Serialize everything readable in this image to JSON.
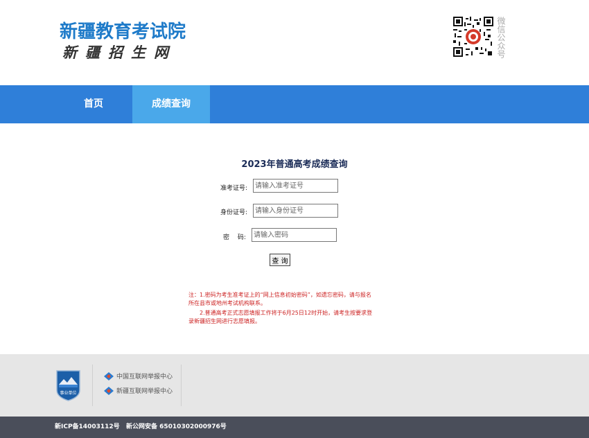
{
  "header": {
    "logo_main": "新疆教育考试院",
    "logo_sub": "新疆招生网",
    "qr_caption": "微信公众号"
  },
  "nav": {
    "items": [
      {
        "label": "首页"
      },
      {
        "label": "成绩查询"
      }
    ]
  },
  "form": {
    "title": "2023年普通高考成绩查询",
    "exam_no_label": "准考证号:",
    "exam_no_placeholder": "请输入准考证号",
    "id_no_label": "身份证号:",
    "id_no_placeholder": "请输入身份证号",
    "password_label": "密　 码:",
    "password_placeholder": "请输入密码",
    "submit_label": "查 询"
  },
  "notes": {
    "line1": "注：1.密码为考生准考证上的“网上信息初始密码”，如遗忘密码，请与报名所在县市或地州考试机构联系。",
    "line2": "　　2.普通高考正式志愿填报工作将于6月25日12时开始，请考生按要求登录新疆招生网进行志愿填报。"
  },
  "footer": {
    "badge_text": "事业单位",
    "report1": "中国互联网举报中心",
    "report2": "新疆互联网举报中心",
    "icp": "新ICP备14003112号",
    "gongan": "新公网安备 65010302000976号"
  },
  "colors": {
    "nav_bg": "#2f7fd9",
    "nav_active": "#4aa8ea",
    "logo_blue": "#1f7bc9",
    "note_red": "#cc2222",
    "footer_bg": "#e6e6e6",
    "bottom_bar": "#4a4e5a"
  }
}
